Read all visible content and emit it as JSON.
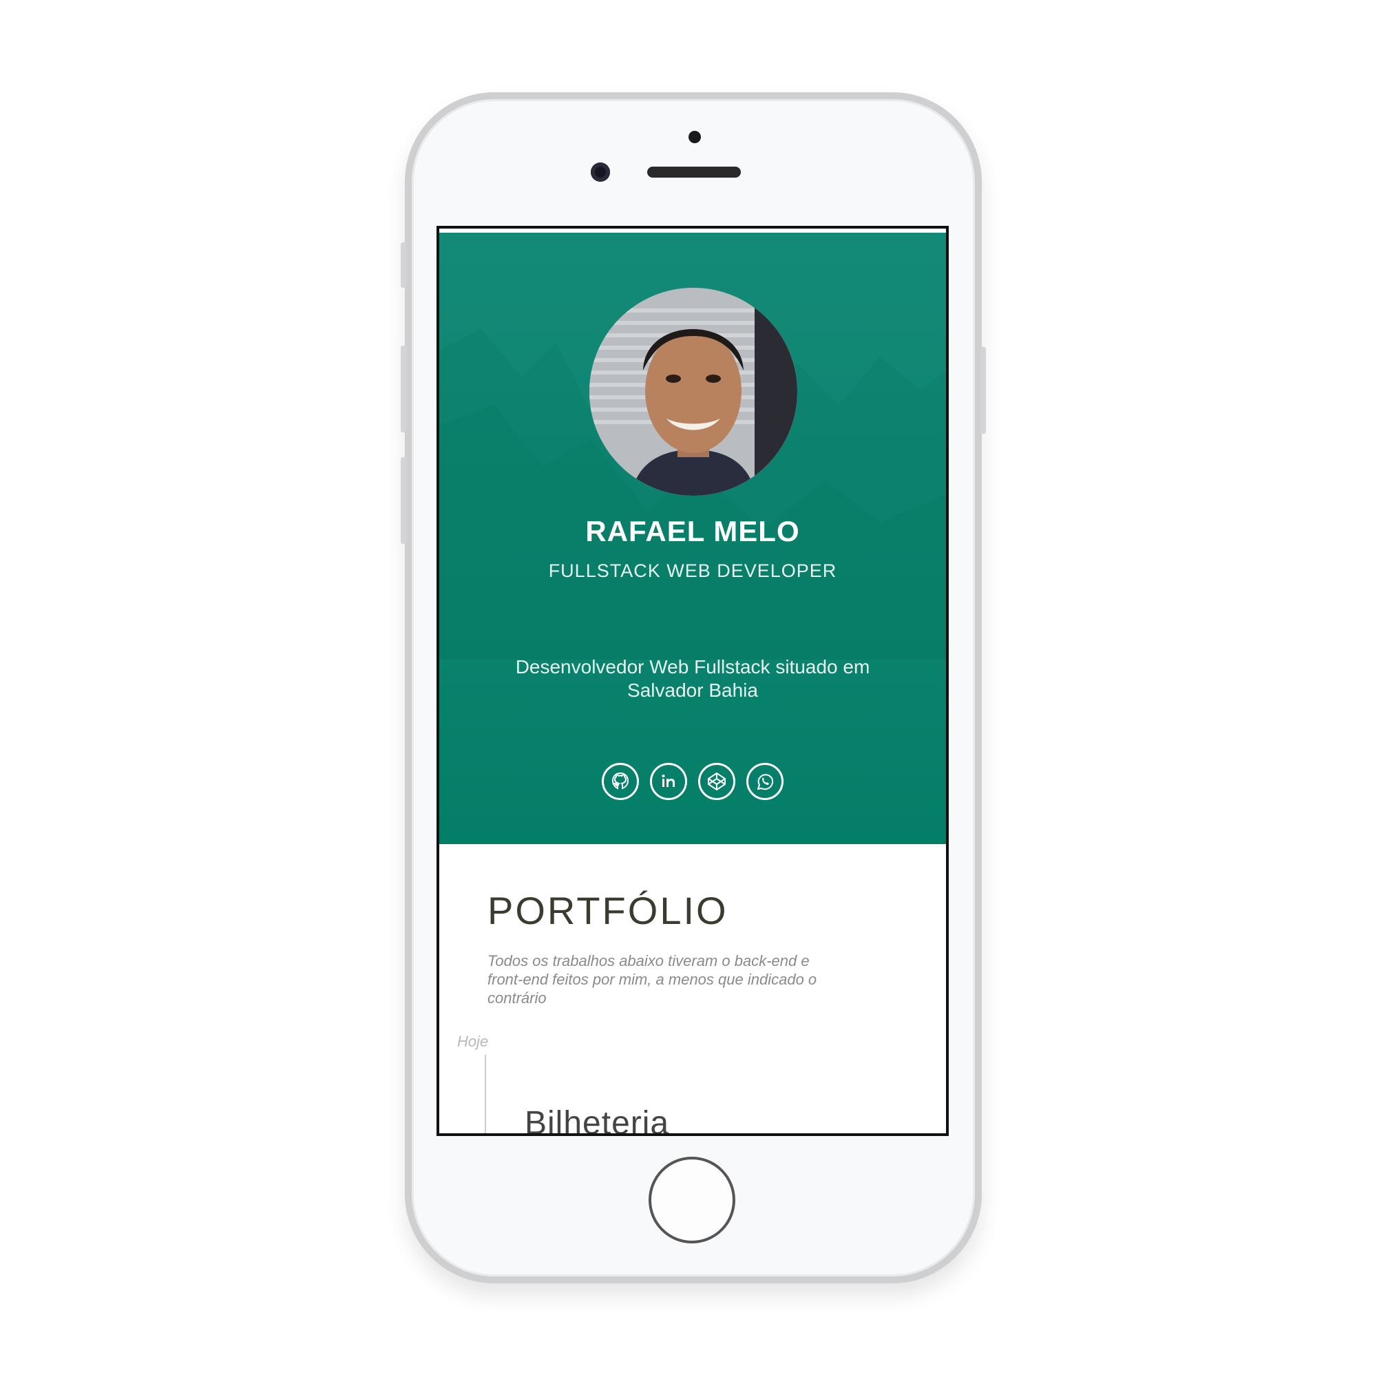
{
  "profile": {
    "name": "RAFAEL MELO",
    "role": "FULLSTACK WEB DEVELOPER",
    "bio": "Desenvolvedor Web Fullstack situado em Salvador Bahia"
  },
  "socials": [
    {
      "icon": "github-icon"
    },
    {
      "icon": "linkedin-icon"
    },
    {
      "icon": "codepen-icon"
    },
    {
      "icon": "whatsapp-icon"
    }
  ],
  "portfolio": {
    "title": "PORTFÓLIO",
    "description": "Todos os trabalhos abaixo tiveram o back-end e front-end feitos por mim, a menos que indicado o contrário",
    "timeline_label": "Hoje",
    "first_project_partial": "Bilheteria"
  },
  "colors": {
    "hero_top": "#138a77",
    "hero_bottom": "#037e67",
    "heading": "#3b3b2f"
  }
}
